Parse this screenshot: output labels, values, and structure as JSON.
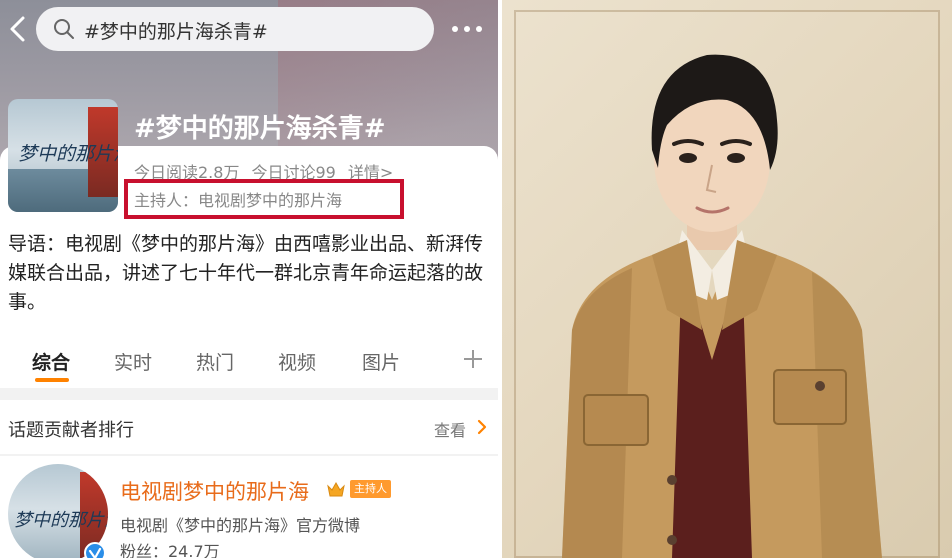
{
  "header": {
    "search_text": "#梦中的那片海杀青#"
  },
  "topic": {
    "cover_title": "梦中的那片海",
    "title": "#梦中的那片海杀青#",
    "read_today": "今日阅读2.8万",
    "discuss_today": "今日讨论99",
    "details_link": "详情>",
    "host": "主持人：电视剧梦中的那片海",
    "intro": "导语：电视剧《梦中的那片海》由西嘻影业出品、新湃传媒联合出品，讲述了七十年代一群北京青年命运起落的故事。"
  },
  "tabs": [
    {
      "label": "综合"
    },
    {
      "label": "实时"
    },
    {
      "label": "热门"
    },
    {
      "label": "视频"
    },
    {
      "label": "图片"
    }
  ],
  "ranking": {
    "title": "话题贡献者排行",
    "view_label": "查看"
  },
  "contributor": {
    "avatar_text": "梦中的那片海",
    "name": "电视剧梦中的那片海",
    "badge": "主持人",
    "desc": "电视剧《梦中的那片海》官方微博",
    "fans": "粉丝：24.7万"
  },
  "colors": {
    "accent": "#ff8200",
    "highlight": "#c8102e",
    "name": "#e86b1a"
  }
}
